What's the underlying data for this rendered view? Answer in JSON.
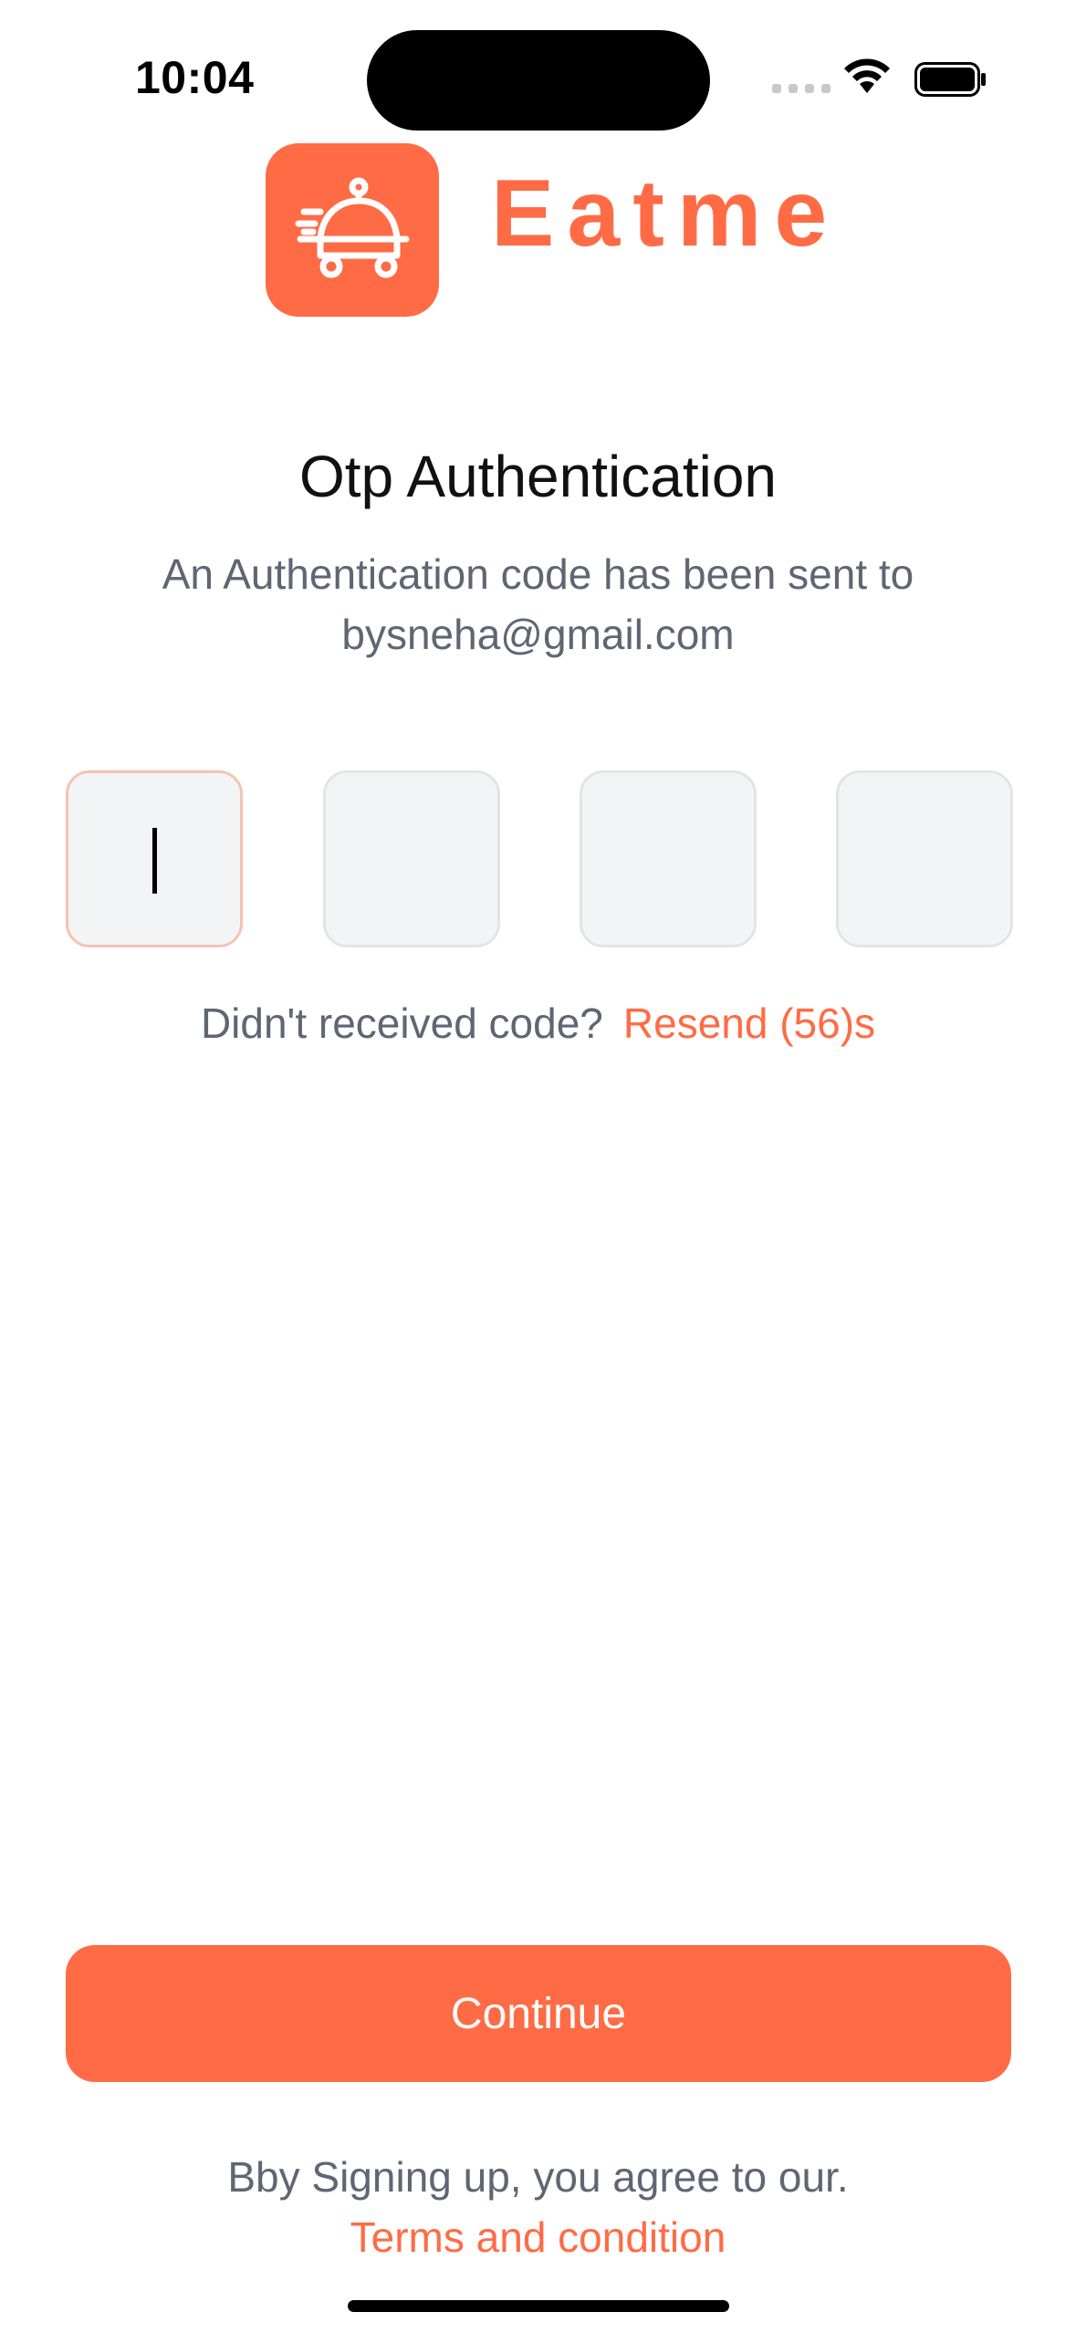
{
  "status_bar": {
    "time": "10:04"
  },
  "brand": {
    "name": "Eatme",
    "logo_icon": "delivery-cart-icon",
    "accent_color": "#ff6b45"
  },
  "header": {
    "title": "Otp Authentication",
    "subtitle_line1": "An Authentication code has been sent to",
    "subtitle_line2": "bysneha@gmail.com"
  },
  "otp": {
    "digits": [
      "",
      "",
      "",
      ""
    ],
    "active_index": 0
  },
  "resend": {
    "prompt": "Didn't received code?",
    "link": "Resend (56)s"
  },
  "actions": {
    "continue_label": "Continue"
  },
  "footer": {
    "agree_text": "Bby Signing up, you agree to our.",
    "terms_link": "Terms and condition"
  }
}
